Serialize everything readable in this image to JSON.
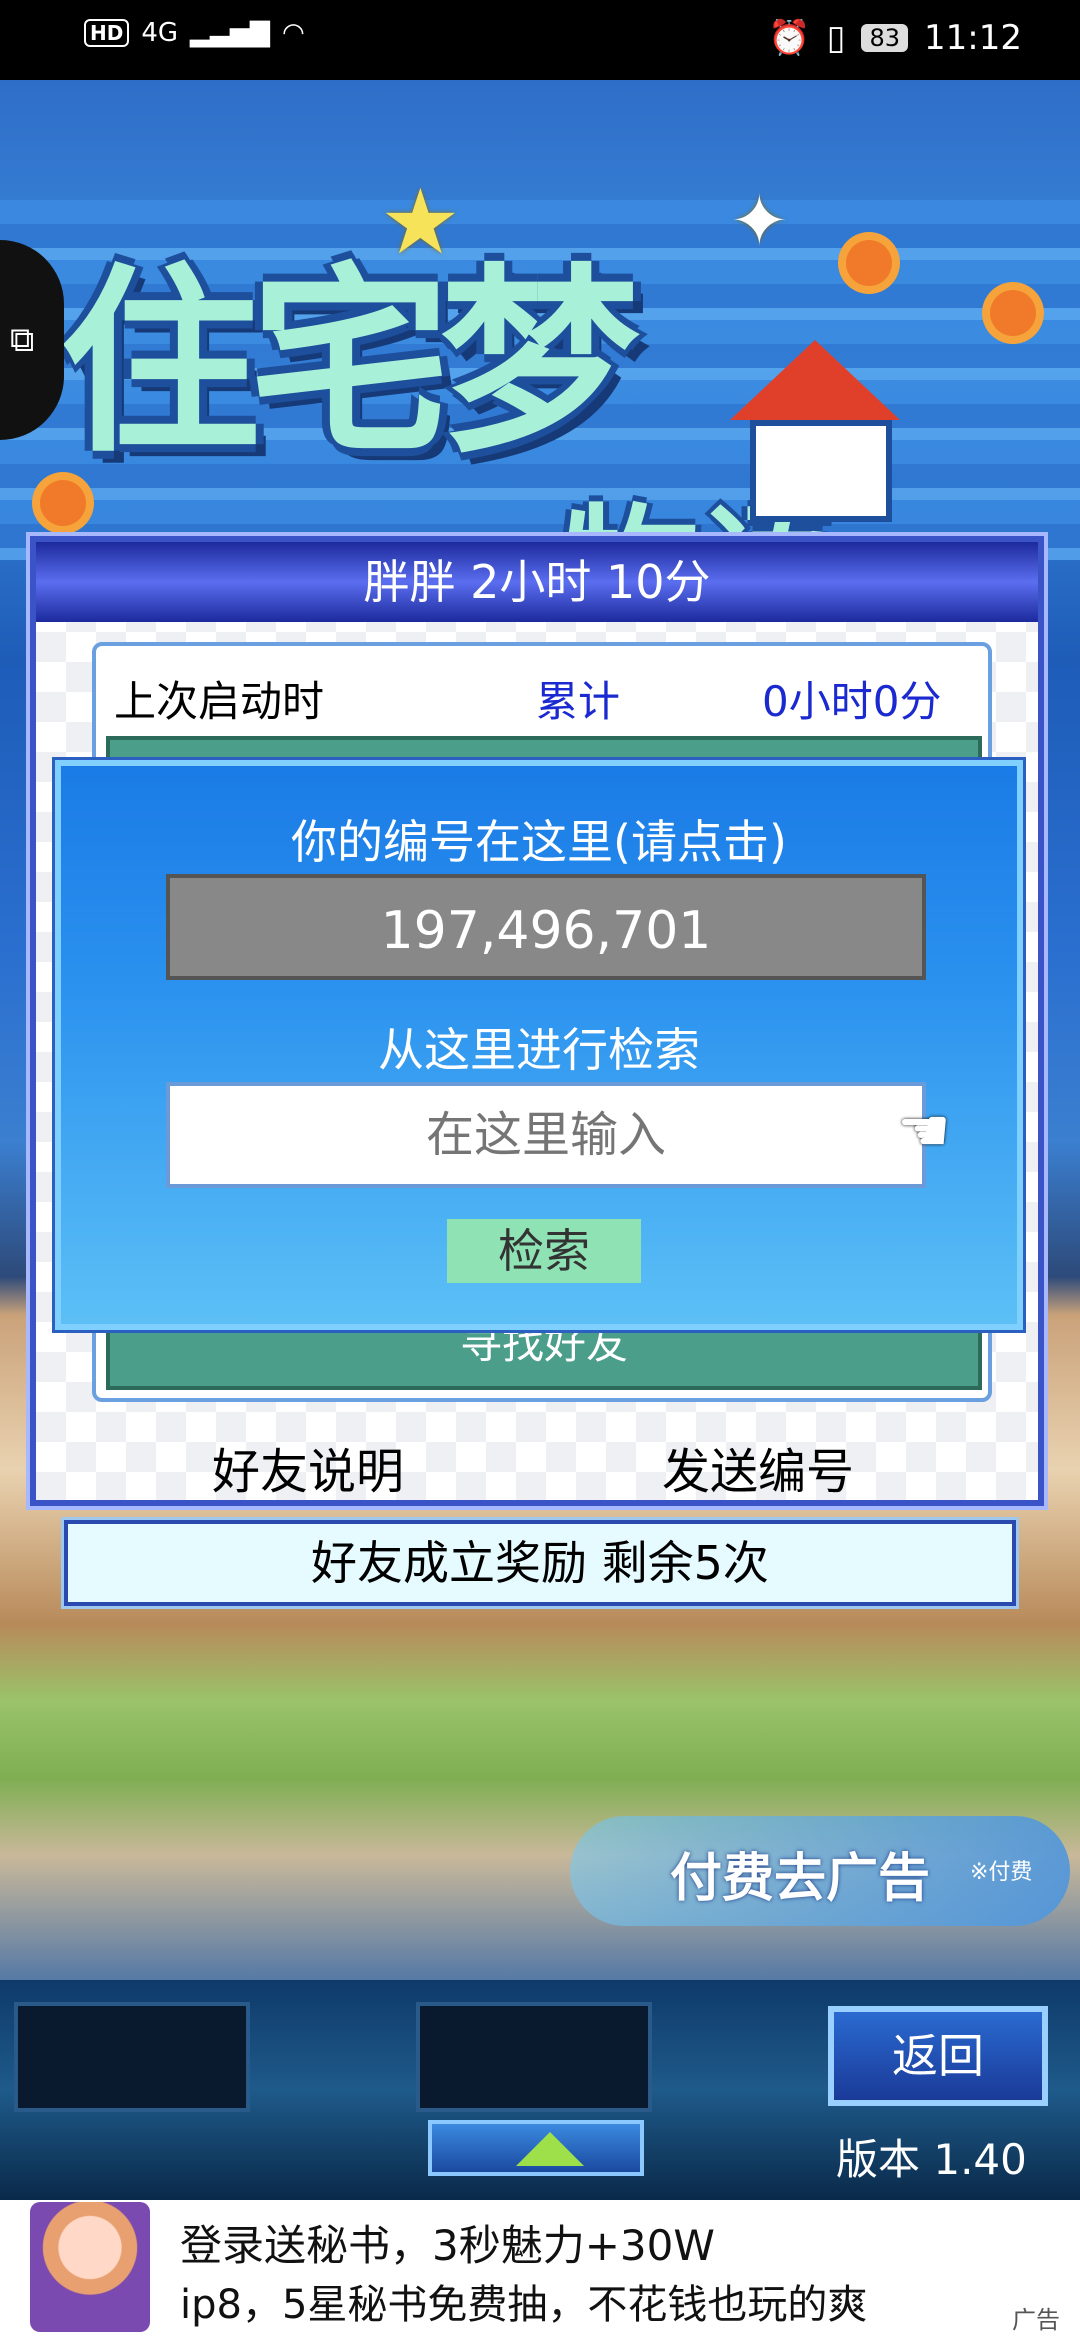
{
  "status_bar": {
    "left_badges": "HD",
    "network": "4G",
    "battery": "83",
    "time": "11:12"
  },
  "logo": {
    "title_line1": "住宅梦",
    "title_line2": "物语"
  },
  "panel": {
    "title": "胖胖  2小时 10分",
    "last_launch_label": "上次启动时",
    "total_label": "累计",
    "total_value": "0小时0分",
    "find_friend_label": "寻找好友",
    "friend_help_link": "好友说明",
    "send_id_link": "发送编号"
  },
  "dialog": {
    "title": "你的编号在这里(请点击)",
    "player_id": "197,496,701",
    "search_label": "从这里进行检索",
    "search_placeholder": "在这里输入",
    "search_button": "检索"
  },
  "reward_bar": "好友成立奖励  剩余5次",
  "pay_button": {
    "label": "付费去广告",
    "sub": "※付费"
  },
  "game_nav": {
    "back_button": "返回",
    "version": "版本 1.40"
  },
  "ad": {
    "line1": "登录送秘书，3秒魅力+30W",
    "line2": "ip8，5星秘书免费抽，不花钱也玩的爽",
    "tag": "广告"
  },
  "colors": {
    "dialog_top": "#1a7be6",
    "dialog_bottom": "#5cc0f6",
    "panel_title": "#1c2a9c",
    "search_button_bg": "#8fe2b4"
  }
}
